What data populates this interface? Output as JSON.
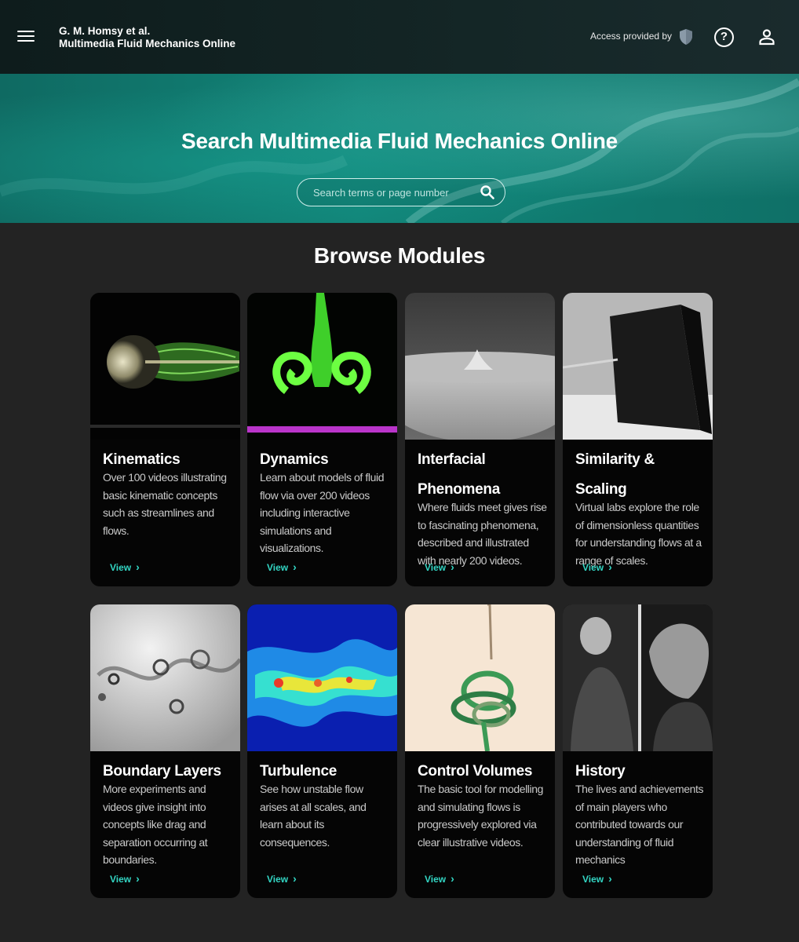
{
  "header": {
    "author": "G. M. Homsy et al.",
    "title": "Multimedia Fluid Mechanics Online",
    "access_label": "Access provided by",
    "help_symbol": "?",
    "menu_icon": "hamburger-menu-icon",
    "shield_icon": "institution-shield-icon",
    "help_icon": "help-circle-icon",
    "account_icon": "user-account-icon"
  },
  "hero": {
    "title": "Search Multimedia Fluid Mechanics Online",
    "search_placeholder": "Search terms or page number",
    "search_icon": "search-icon"
  },
  "browse": {
    "title": "Browse Modules",
    "view_label": "View",
    "modules": [
      {
        "title": "Kinematics",
        "description": "Over 100 videos illustrating basic kinematic concepts such as streamlines and flows."
      },
      {
        "title": "Dynamics",
        "description": "Learn about models of fluid flow via over 200 videos including interactive simulations and visualizations."
      },
      {
        "title": "Interfacial Phenomena",
        "description": "Where fluids meet gives rise to fascinating phenomena, described and illustrated with nearly 200 videos."
      },
      {
        "title": "Similarity & Scaling",
        "description": "Virtual labs explore the role of dimensionless quantities for understanding flows at a range of scales."
      },
      {
        "title": "Boundary Layers",
        "description": "More experiments and videos give insight into concepts like drag and separation occurring at boundaries."
      },
      {
        "title": "Turbulence",
        "description": "See how unstable flow arises at all scales, and learn about its consequences."
      },
      {
        "title": "Control Volumes",
        "description": "The basic tool for modelling and simulating flows is progressively explored via clear illustrative videos."
      },
      {
        "title": "History",
        "description": "The lives and achievements of main players who contributed towards our understanding of fluid mechanics"
      }
    ]
  },
  "colors": {
    "page_bg": "#232323",
    "card_bg": "#050505",
    "accent": "#33d6c4",
    "hero_teal": "#118478"
  }
}
